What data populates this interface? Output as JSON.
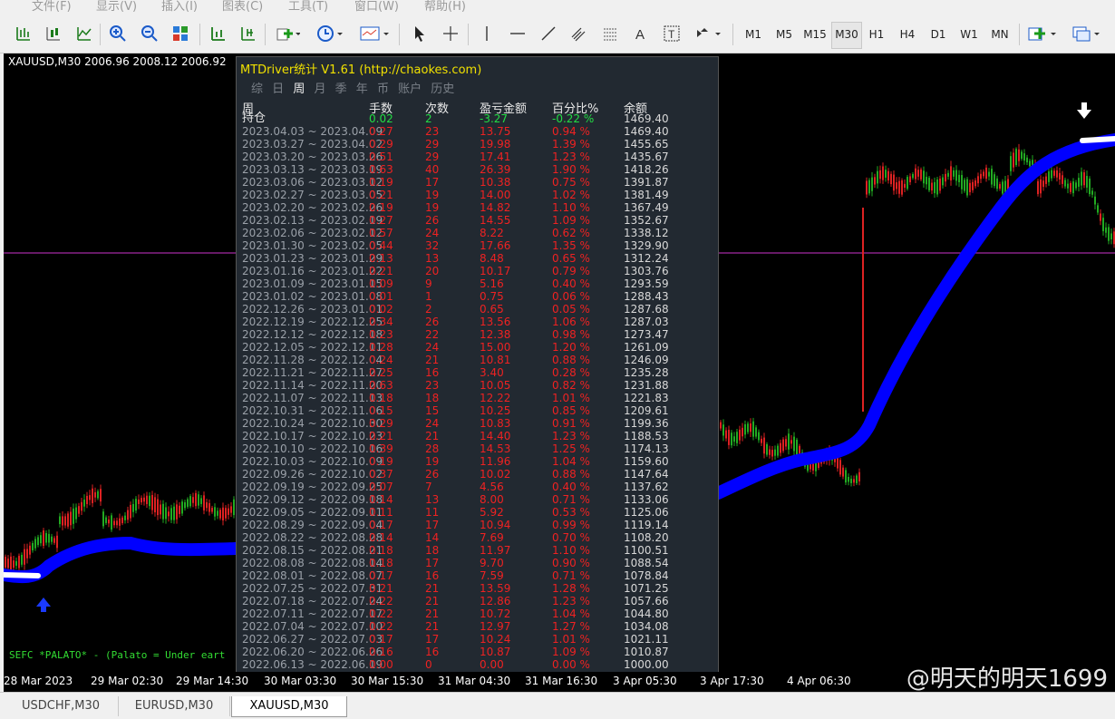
{
  "menu": [
    "文件(F)",
    "显示(V)",
    "插入(I)",
    "图表(C)",
    "工具(T)",
    "窗口(W)",
    "帮助(H)"
  ],
  "timeframes": [
    "M1",
    "M5",
    "M15",
    "M30",
    "H1",
    "H4",
    "D1",
    "W1",
    "MN"
  ],
  "active_timeframe": "M30",
  "chart": {
    "symbol_header": "XAUUSD,M30  2006.96 2008.12 2006.92",
    "sefc_text": "SEFC *PALATO* - (Palato = Under eart",
    "time_labels": [
      "28 Mar 2023",
      "29 Mar 02:30",
      "29 Mar 14:30",
      "30 Mar 03:30",
      "30 Mar 15:30",
      "31 Mar 04:30",
      "31 Mar 16:30",
      "3 Apr 05:30",
      "3 Apr 17:30",
      "4 Apr 06:30"
    ],
    "colors": {
      "bull": "#22aa22",
      "bear": "#dd2222",
      "ma": "#0000ff",
      "hline": "#cc33cc"
    }
  },
  "panel": {
    "title": "MTDriver统计 V1.61  (http://chaokes.com)",
    "tabs": [
      "综",
      "日",
      "周",
      "月",
      "季",
      "年",
      "币",
      "账户",
      "历史"
    ],
    "active_tab": "周",
    "headers": {
      "week": "周",
      "lots": "手数",
      "count": "次数",
      "pl": "盈亏金额",
      "pct": "百分比%",
      "balance": "余额"
    },
    "holding": {
      "label": "持仓",
      "lots": "0.02",
      "count": "2",
      "pl": "-3.27",
      "pct": "-0.22 %",
      "balance": "1469.40"
    },
    "rows": [
      {
        "week": "2023.04.03 ~ 2023.04.09",
        "lots": "0.27",
        "count": "23",
        "pl": "13.75",
        "pct": "0.94 %",
        "balance": "1469.40"
      },
      {
        "week": "2023.03.27 ~ 2023.04.02",
        "lots": "0.29",
        "count": "29",
        "pl": "19.98",
        "pct": "1.39 %",
        "balance": "1455.65"
      },
      {
        "week": "2023.03.20 ~ 2023.03.26",
        "lots": "0.51",
        "count": "29",
        "pl": "17.41",
        "pct": "1.23 %",
        "balance": "1435.67"
      },
      {
        "week": "2023.03.13 ~ 2023.03.19",
        "lots": "0.63",
        "count": "40",
        "pl": "26.39",
        "pct": "1.90 %",
        "balance": "1418.26"
      },
      {
        "week": "2023.03.06 ~ 2023.03.12",
        "lots": "0.19",
        "count": "17",
        "pl": "10.38",
        "pct": "0.75 %",
        "balance": "1391.87"
      },
      {
        "week": "2023.02.27 ~ 2023.03.05",
        "lots": "0.21",
        "count": "19",
        "pl": "14.00",
        "pct": "1.02 %",
        "balance": "1381.49"
      },
      {
        "week": "2023.02.20 ~ 2023.02.26",
        "lots": "0.19",
        "count": "19",
        "pl": "14.82",
        "pct": "1.10 %",
        "balance": "1367.49"
      },
      {
        "week": "2023.02.13 ~ 2023.02.19",
        "lots": "0.27",
        "count": "26",
        "pl": "14.55",
        "pct": "1.09 %",
        "balance": "1352.67"
      },
      {
        "week": "2023.02.06 ~ 2023.02.12",
        "lots": "0.57",
        "count": "24",
        "pl": "8.22",
        "pct": "0.62 %",
        "balance": "1338.12"
      },
      {
        "week": "2023.01.30 ~ 2023.02.05",
        "lots": "0.44",
        "count": "32",
        "pl": "17.66",
        "pct": "1.35 %",
        "balance": "1329.90"
      },
      {
        "week": "2023.01.23 ~ 2023.01.29",
        "lots": "0.13",
        "count": "13",
        "pl": "8.48",
        "pct": "0.65 %",
        "balance": "1312.24"
      },
      {
        "week": "2023.01.16 ~ 2023.01.22",
        "lots": "0.21",
        "count": "20",
        "pl": "10.17",
        "pct": "0.79 %",
        "balance": "1303.76"
      },
      {
        "week": "2023.01.09 ~ 2023.01.15",
        "lots": "0.09",
        "count": "9",
        "pl": "5.16",
        "pct": "0.40 %",
        "balance": "1293.59"
      },
      {
        "week": "2023.01.02 ~ 2023.01.08",
        "lots": "0.01",
        "count": "1",
        "pl": "0.75",
        "pct": "0.06 %",
        "balance": "1288.43"
      },
      {
        "week": "2022.12.26 ~ 2023.01.01",
        "lots": "0.02",
        "count": "2",
        "pl": "0.65",
        "pct": "0.05 %",
        "balance": "1287.68"
      },
      {
        "week": "2022.12.19 ~ 2022.12.25",
        "lots": "0.34",
        "count": "26",
        "pl": "13.56",
        "pct": "1.06 %",
        "balance": "1287.03"
      },
      {
        "week": "2022.12.12 ~ 2022.12.18",
        "lots": "0.23",
        "count": "22",
        "pl": "12.38",
        "pct": "0.98 %",
        "balance": "1273.47"
      },
      {
        "week": "2022.12.05 ~ 2022.12.11",
        "lots": "0.28",
        "count": "24",
        "pl": "15.00",
        "pct": "1.20 %",
        "balance": "1261.09"
      },
      {
        "week": "2022.11.28 ~ 2022.12.04",
        "lots": "0.24",
        "count": "21",
        "pl": "10.81",
        "pct": "0.88 %",
        "balance": "1246.09"
      },
      {
        "week": "2022.11.21 ~ 2022.11.27",
        "lots": "0.25",
        "count": "16",
        "pl": "3.40",
        "pct": "0.28 %",
        "balance": "1235.28"
      },
      {
        "week": "2022.11.14 ~ 2022.11.20",
        "lots": "0.63",
        "count": "23",
        "pl": "10.05",
        "pct": "0.82 %",
        "balance": "1231.88"
      },
      {
        "week": "2022.11.07 ~ 2022.11.13",
        "lots": "0.18",
        "count": "18",
        "pl": "12.22",
        "pct": "1.01 %",
        "balance": "1221.83"
      },
      {
        "week": "2022.10.31 ~ 2022.11.06",
        "lots": "0.15",
        "count": "15",
        "pl": "10.25",
        "pct": "0.85 %",
        "balance": "1209.61"
      },
      {
        "week": "2022.10.24 ~ 2022.10.30",
        "lots": "0.29",
        "count": "24",
        "pl": "10.83",
        "pct": "0.91 %",
        "balance": "1199.36"
      },
      {
        "week": "2022.10.17 ~ 2022.10.23",
        "lots": "0.21",
        "count": "21",
        "pl": "14.40",
        "pct": "1.23 %",
        "balance": "1188.53"
      },
      {
        "week": "2022.10.10 ~ 2022.10.16",
        "lots": "0.39",
        "count": "28",
        "pl": "14.53",
        "pct": "1.25 %",
        "balance": "1174.13"
      },
      {
        "week": "2022.10.03 ~ 2022.10.09",
        "lots": "0.19",
        "count": "19",
        "pl": "11.96",
        "pct": "1.04 %",
        "balance": "1159.60"
      },
      {
        "week": "2022.09.26 ~ 2022.10.02",
        "lots": "0.37",
        "count": "26",
        "pl": "10.02",
        "pct": "0.88 %",
        "balance": "1147.64"
      },
      {
        "week": "2022.09.19 ~ 2022.09.25",
        "lots": "0.07",
        "count": "7",
        "pl": "4.56",
        "pct": "0.40 %",
        "balance": "1137.62"
      },
      {
        "week": "2022.09.12 ~ 2022.09.18",
        "lots": "0.14",
        "count": "13",
        "pl": "8.00",
        "pct": "0.71 %",
        "balance": "1133.06"
      },
      {
        "week": "2022.09.05 ~ 2022.09.11",
        "lots": "0.11",
        "count": "11",
        "pl": "5.92",
        "pct": "0.53 %",
        "balance": "1125.06"
      },
      {
        "week": "2022.08.29 ~ 2022.09.04",
        "lots": "0.17",
        "count": "17",
        "pl": "10.94",
        "pct": "0.99 %",
        "balance": "1119.14"
      },
      {
        "week": "2022.08.22 ~ 2022.08.28",
        "lots": "0.14",
        "count": "14",
        "pl": "7.69",
        "pct": "0.70 %",
        "balance": "1108.20"
      },
      {
        "week": "2022.08.15 ~ 2022.08.21",
        "lots": "0.18",
        "count": "18",
        "pl": "11.97",
        "pct": "1.10 %",
        "balance": "1100.51"
      },
      {
        "week": "2022.08.08 ~ 2022.08.14",
        "lots": "0.18",
        "count": "17",
        "pl": "9.70",
        "pct": "0.90 %",
        "balance": "1088.54"
      },
      {
        "week": "2022.08.01 ~ 2022.08.07",
        "lots": "0.17",
        "count": "16",
        "pl": "7.59",
        "pct": "0.71 %",
        "balance": "1078.84"
      },
      {
        "week": "2022.07.25 ~ 2022.07.31",
        "lots": "0.21",
        "count": "21",
        "pl": "13.59",
        "pct": "1.28 %",
        "balance": "1071.25"
      },
      {
        "week": "2022.07.18 ~ 2022.07.24",
        "lots": "0.22",
        "count": "21",
        "pl": "12.86",
        "pct": "1.23 %",
        "balance": "1057.66"
      },
      {
        "week": "2022.07.11 ~ 2022.07.17",
        "lots": "0.22",
        "count": "21",
        "pl": "10.72",
        "pct": "1.04 %",
        "balance": "1044.80"
      },
      {
        "week": "2022.07.04 ~ 2022.07.10",
        "lots": "0.22",
        "count": "21",
        "pl": "12.97",
        "pct": "1.27 %",
        "balance": "1034.08"
      },
      {
        "week": "2022.06.27 ~ 2022.07.03",
        "lots": "0.17",
        "count": "17",
        "pl": "10.24",
        "pct": "1.01 %",
        "balance": "1021.11"
      },
      {
        "week": "2022.06.20 ~ 2022.06.26",
        "lots": "0.16",
        "count": "16",
        "pl": "10.87",
        "pct": "1.09 %",
        "balance": "1010.87"
      },
      {
        "week": "2022.06.13 ~ 2022.06.19",
        "lots": "0.00",
        "count": "0",
        "pl": "0.00",
        "pct": "0.00 %",
        "balance": "1000.00"
      }
    ]
  },
  "bottom_tabs": [
    "USDCHF,M30",
    "EURUSD,M30",
    "XAUUSD,M30"
  ],
  "active_bottom_tab": "XAUUSD,M30",
  "watermark": "@明天的明天1699"
}
